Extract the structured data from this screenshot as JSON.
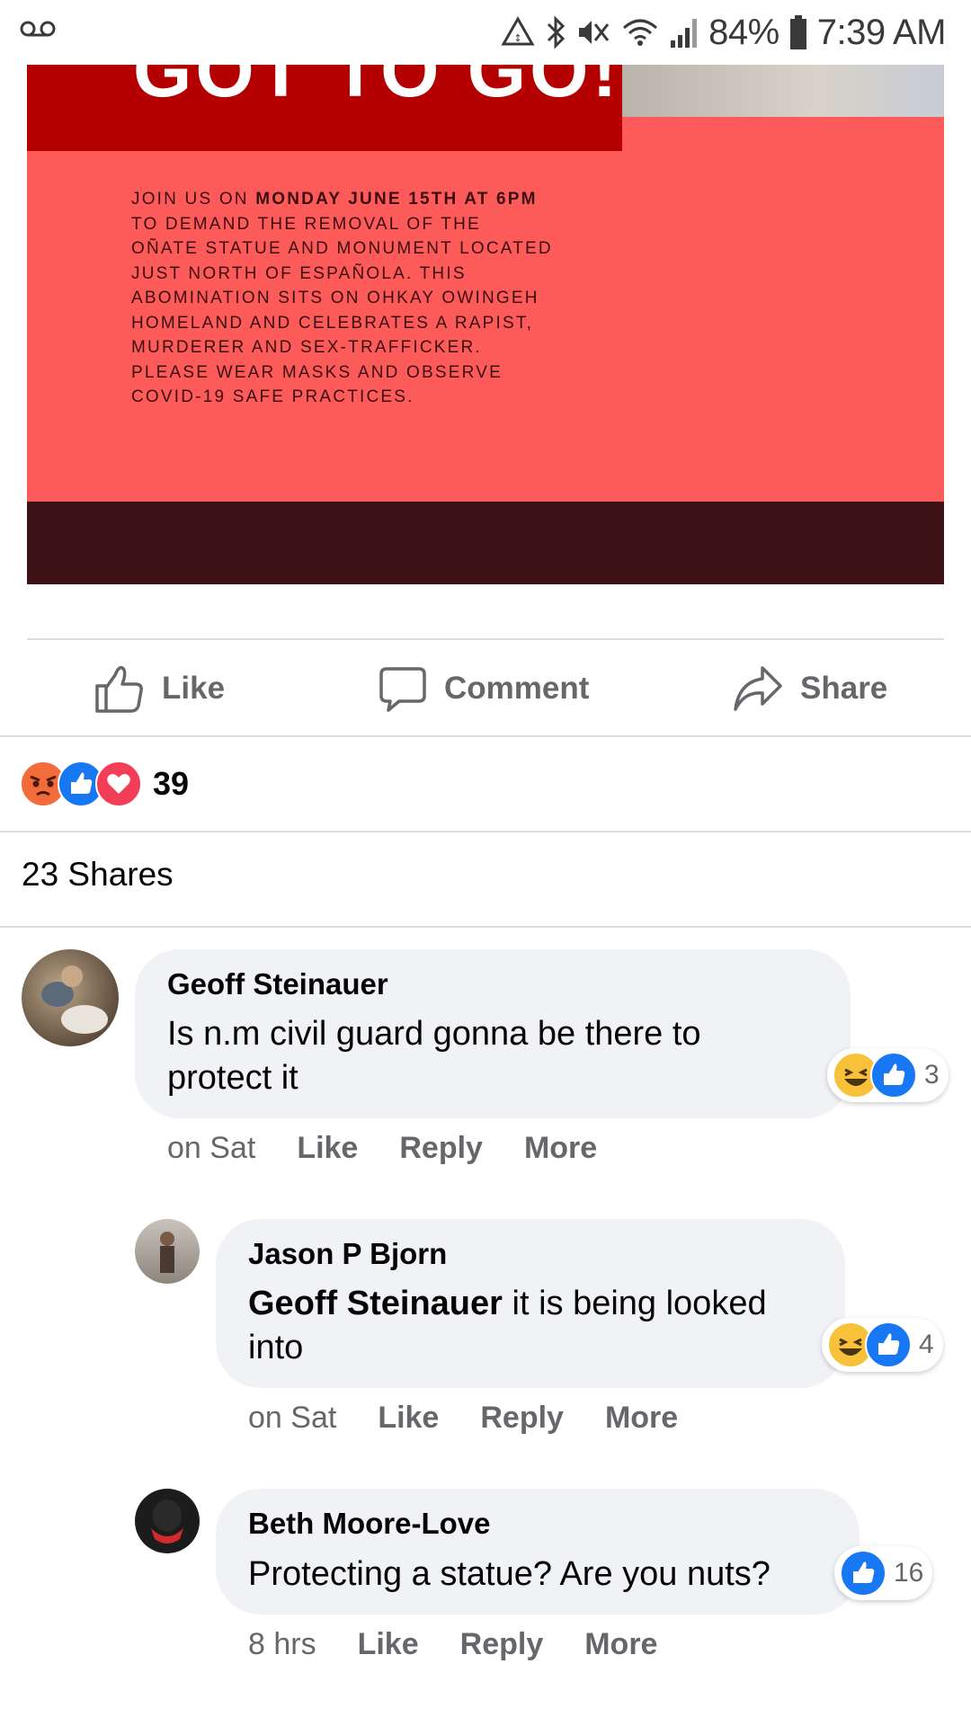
{
  "status_bar": {
    "battery": "84%",
    "time": "7:39 AM",
    "icons": [
      "voicemail-icon",
      "data-saver-icon",
      "bluetooth-icon",
      "mute-icon",
      "wifi-icon",
      "signal-icon",
      "battery-icon"
    ]
  },
  "post_image": {
    "title": "GOT TO GO!",
    "body_parts": [
      {
        "text": "JOIN US ON ",
        "bold": false
      },
      {
        "text": "MONDAY JUNE 15TH AT 6PM",
        "bold": true
      },
      {
        "text": " TO DEMAND THE REMOVAL OF THE OÑATE STATUE AND MONUMENT LOCATED JUST NORTH OF ESPAÑOLA. THIS ABOMINATION SITS ON OHKAY OWINGEH HOMELAND AND CELEBRATES A RAPIST, MURDERER AND SEX-TRAFFICKER. PLEASE WEAR MASKS AND OBSERVE COVID-19 SAFE PRACTICES.",
        "bold": false
      }
    ],
    "colors": {
      "background": "#fd5a5a",
      "title_block": "#b40000",
      "footer": "#3d1214"
    }
  },
  "actions": {
    "like": "Like",
    "comment": "Comment",
    "share": "Share"
  },
  "reactions": {
    "types": [
      "angry",
      "like",
      "love"
    ],
    "count": "39"
  },
  "shares": "23 Shares",
  "comments": [
    {
      "author": "Geoff Steinauer",
      "mention": "",
      "text": "Is n.m civil guard gonna be there to protect it",
      "time": "on Sat",
      "like": "Like",
      "reply": "Reply",
      "more": "More",
      "reactions": [
        "haha",
        "like"
      ],
      "reaction_count": "3"
    },
    {
      "author": "Jason P Bjorn",
      "mention": "Geoff Steinauer",
      "text": " it is being looked into",
      "time": "on Sat",
      "like": "Like",
      "reply": "Reply",
      "more": "More",
      "reactions": [
        "haha",
        "like"
      ],
      "reaction_count": "4"
    },
    {
      "author": "Beth Moore-Love",
      "mention": "",
      "text": "Protecting a statue? Are you nuts?",
      "time": "8 hrs",
      "like": "Like",
      "reply": "Reply",
      "more": "More",
      "reactions": [
        "like"
      ],
      "reaction_count": "16"
    }
  ]
}
